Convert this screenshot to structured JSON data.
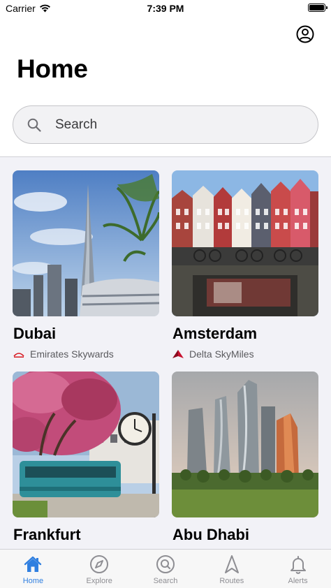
{
  "status_bar": {
    "carrier": "Carrier",
    "time": "7:39 PM",
    "battery_level": 1.0
  },
  "header": {
    "title": "Home",
    "profile_icon": "person-circle-icon"
  },
  "search": {
    "placeholder": "Search"
  },
  "destinations": [
    {
      "city": "Dubai",
      "airline": "Emirates Skywards",
      "logo_color": "#d71921"
    },
    {
      "city": "Amsterdam",
      "airline": "Delta SkyMiles",
      "logo_color": "#c8102e"
    },
    {
      "city": "Frankfurt",
      "airline": "",
      "logo_color": "#d71921"
    },
    {
      "city": "Abu Dhabi",
      "airline": "",
      "logo_color": "#d71921"
    }
  ],
  "tabs": [
    {
      "label": "Home",
      "icon": "house-icon",
      "active": true
    },
    {
      "label": "Explore",
      "icon": "compass-icon",
      "active": false
    },
    {
      "label": "Search",
      "icon": "magnifier-icon",
      "active": false
    },
    {
      "label": "Routes",
      "icon": "navigation-arrow-icon",
      "active": false
    },
    {
      "label": "Alerts",
      "icon": "bell-icon",
      "active": false
    }
  ],
  "colors": {
    "accent": "#2f7fe0",
    "inactive": "#8e8e93",
    "background": "#f2f2f7"
  }
}
